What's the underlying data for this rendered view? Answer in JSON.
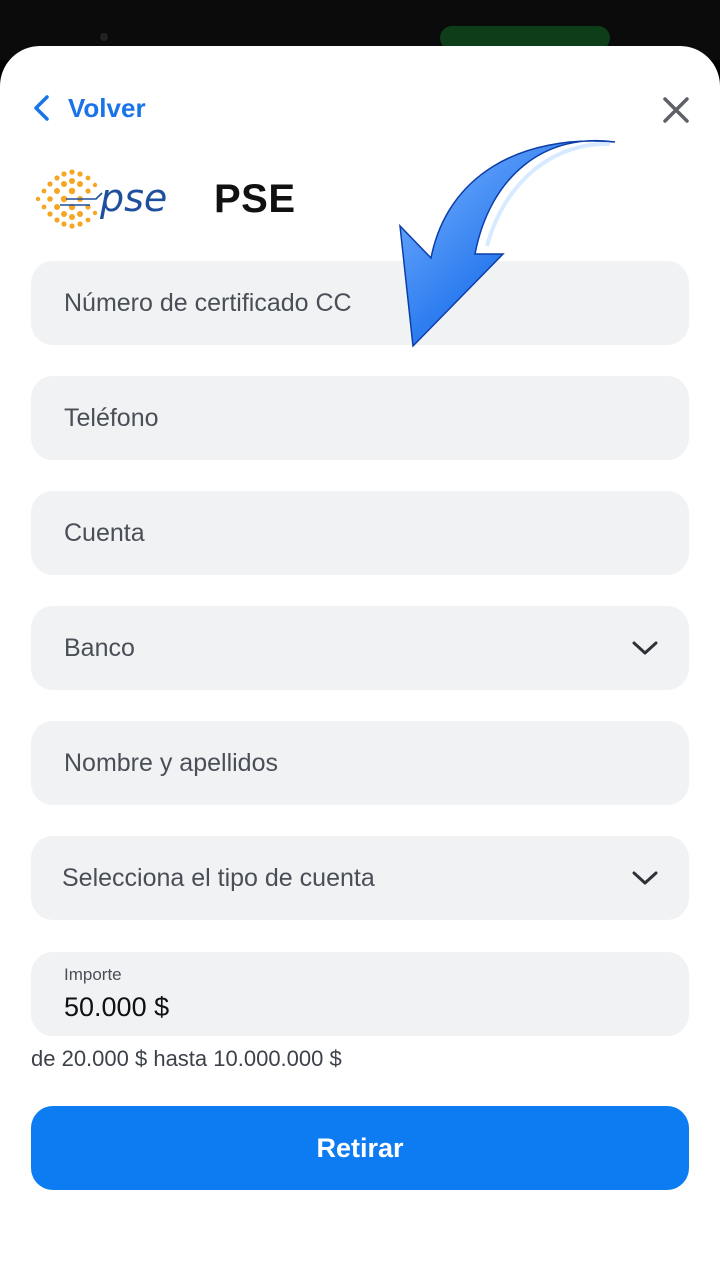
{
  "header": {
    "back_label": "Volver",
    "title": "PSE",
    "logo_text": "pse"
  },
  "form": {
    "fields": [
      {
        "placeholder": "Número de certificado CC"
      },
      {
        "placeholder": "Teléfono"
      },
      {
        "placeholder": "Cuenta"
      },
      {
        "placeholder": "Banco",
        "type": "select"
      },
      {
        "placeholder": "Nombre y apellidos"
      },
      {
        "placeholder": "Selecciona el tipo de cuenta",
        "type": "select"
      }
    ],
    "amount": {
      "label": "Importe",
      "value": "50.000 $"
    },
    "range_text": "de 20.000 $ hasta 10.000.000 $",
    "submit_label": "Retirar"
  },
  "colors": {
    "accent": "#0d7cf2",
    "field_bg": "#f1f2f4",
    "logo_orange": "#f5a623",
    "logo_blue": "#1e4f9c"
  },
  "icons": {
    "back": "chevron-left-icon",
    "close": "close-icon",
    "dropdown": "chevron-down-icon",
    "annotation": "curved-arrow-icon"
  }
}
